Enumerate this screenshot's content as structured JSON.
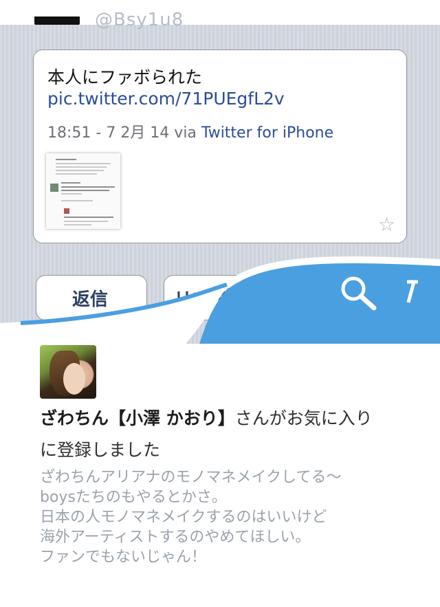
{
  "header": {
    "faded_text": "@Bsy1u8"
  },
  "tweet": {
    "text": "本人にファボられた",
    "link": "pic.twitter.com/71PUEgfL2v",
    "meta_prefix": "18:51 - 7 2月 14 via ",
    "meta_app": "Twitter for iPhone",
    "star_icon": "star-outline-icon"
  },
  "actions": {
    "reply_label": "返信",
    "retweet_label": "リツイ"
  },
  "overlay": {
    "color": "#4a9fe0",
    "icons": [
      "search-icon",
      "compose-icon"
    ]
  },
  "notification": {
    "name": "ざわちん【小澤 かおり】",
    "action_line1": "さんがお気に入り",
    "action_line2": "に登録しました",
    "body_lines": [
      "ざわちんアリアナのモノマネメイクしてる〜",
      "boysたちのもやるとかさ。",
      "日本の人モノマネメイクするのはいいけど",
      "海外アーティストするのやめてほしい。",
      "ファンでもないじゃん！"
    ]
  }
}
